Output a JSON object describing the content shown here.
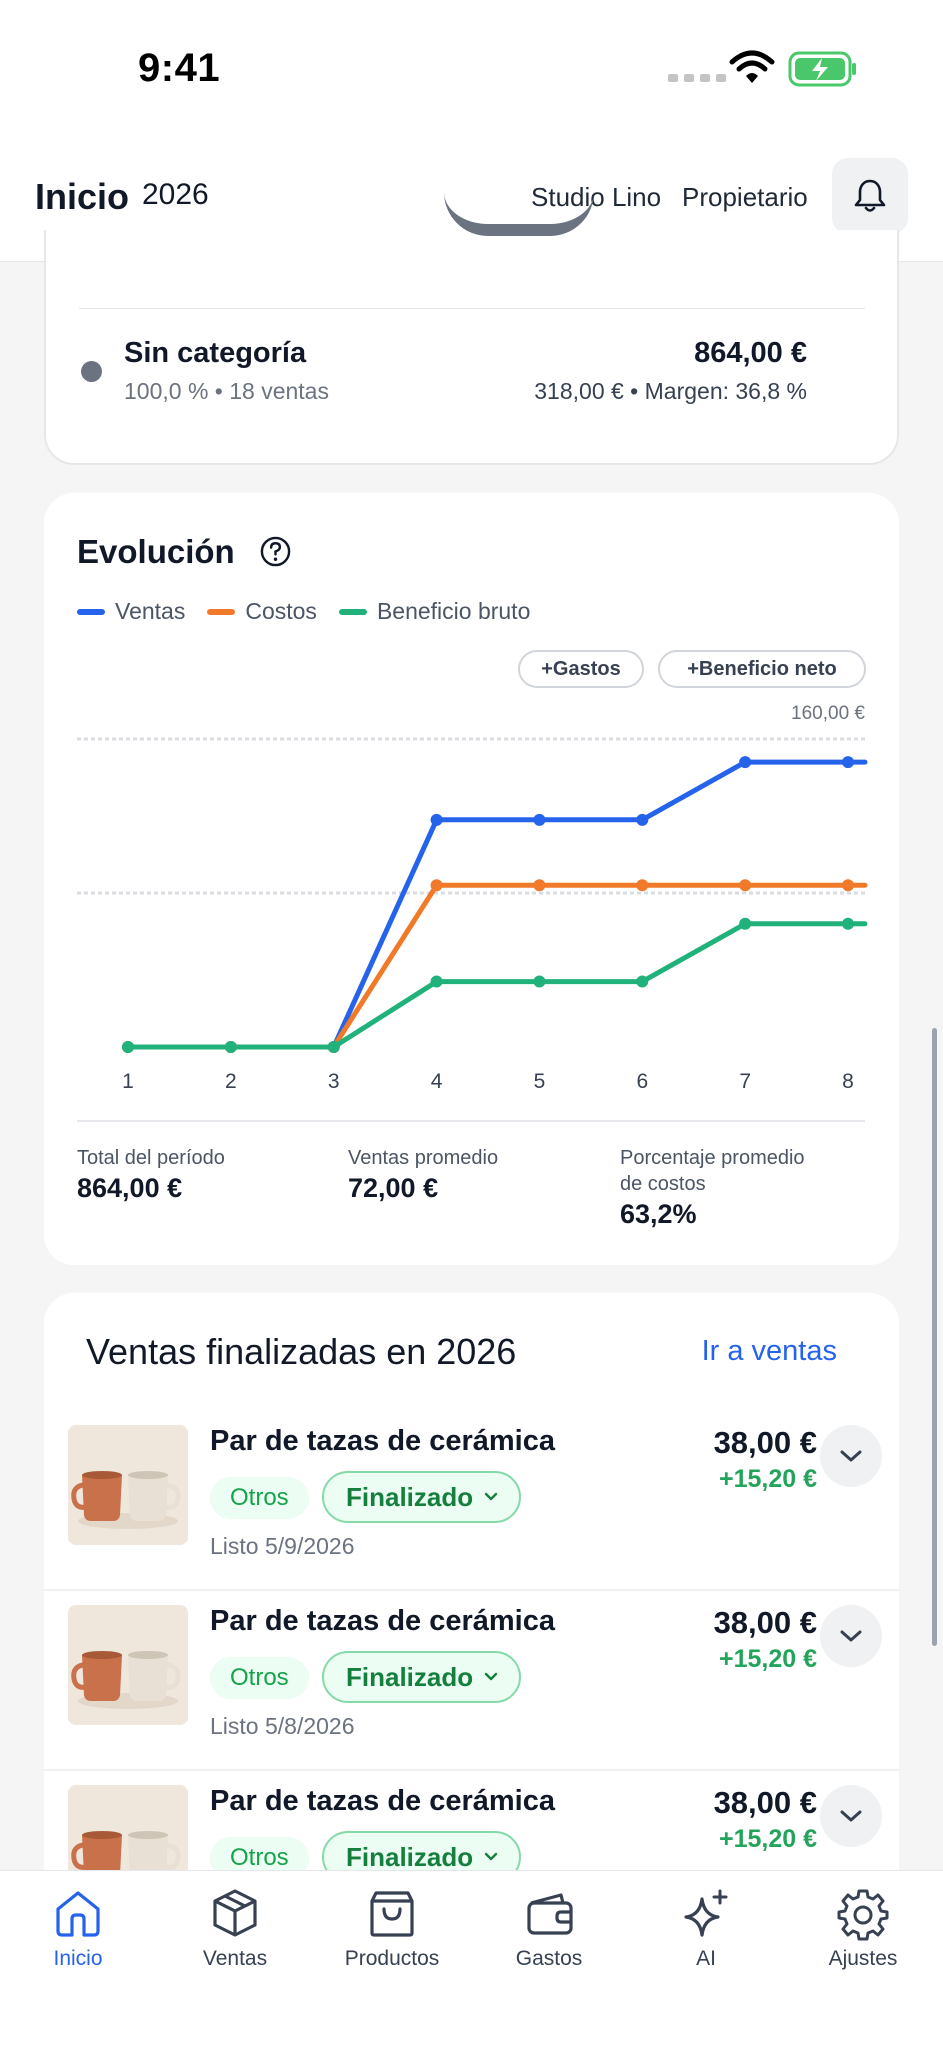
{
  "status_bar": {
    "time": "9:41"
  },
  "header": {
    "title": "Inicio",
    "year": "2026",
    "store": "Studio Lino",
    "role": "Propietario",
    "bell_icon": "bell-icon"
  },
  "category": {
    "name": "Sin categoría",
    "share_and_count": "100,0 %  •  18 ventas",
    "total": "864,00 €",
    "cost_and_margin": "318,00 €  •  Margen: 36,8 %",
    "dot_color": "#6b7280"
  },
  "evolution": {
    "title": "Evolución",
    "help_icon": "question-circle-icon",
    "legend": [
      {
        "label": "Ventas",
        "color": "#2563eb"
      },
      {
        "label": "Costos",
        "color": "#f07a2a"
      },
      {
        "label": "Beneficio bruto",
        "color": "#20b27a"
      }
    ],
    "chips": {
      "gastos": "+Gastos",
      "beneficio_neto": "+Beneficio neto"
    },
    "stats": {
      "total_label": "Total del período",
      "total_value": "864,00 €",
      "avg_label": "Ventas promedio",
      "avg_value": "72,00 €",
      "cost_pct_label_1": "Porcentaje promedio",
      "cost_pct_label_2": "de costos",
      "cost_pct_value": "63,2%"
    }
  },
  "chart_data": {
    "type": "line",
    "x": [
      "1",
      "2",
      "3",
      "4",
      "5",
      "6",
      "7",
      "8"
    ],
    "y_max_label": "160,00 €",
    "ylim": [
      0,
      160
    ],
    "gridlines": [
      160,
      80
    ],
    "series": [
      {
        "name": "Ventas",
        "color": "#2563eb",
        "values": [
          0,
          0,
          0,
          118,
          118,
          118,
          148,
          148
        ]
      },
      {
        "name": "Costos",
        "color": "#f07a2a",
        "values": [
          0,
          0,
          0,
          84,
          84,
          84,
          84,
          84
        ]
      },
      {
        "name": "Beneficio bruto",
        "color": "#20b27a",
        "values": [
          0,
          0,
          0,
          34,
          34,
          34,
          64,
          64
        ]
      }
    ]
  },
  "sales": {
    "title": "Ventas finalizadas en 2026",
    "link": "Ir a ventas",
    "items": [
      {
        "name": "Par de tazas de cerámica",
        "category": "Otros",
        "status": "Finalizado",
        "ready": "Listo 5/9/2026",
        "price": "38,00 €",
        "profit": "+15,20 €"
      },
      {
        "name": "Par de tazas de cerámica",
        "category": "Otros",
        "status": "Finalizado",
        "ready": "Listo 5/8/2026",
        "price": "38,00 €",
        "profit": "+15,20 €"
      },
      {
        "name": "Par de tazas de cerámica",
        "category": "Otros",
        "status": "Finalizado",
        "ready": "",
        "price": "38,00 €",
        "profit": "+15,20 €"
      }
    ]
  },
  "tabs": [
    {
      "label": "Inicio",
      "icon": "home-icon",
      "active": true
    },
    {
      "label": "Ventas",
      "icon": "box-icon",
      "active": false
    },
    {
      "label": "Productos",
      "icon": "shopping-bag-icon",
      "active": false
    },
    {
      "label": "Gastos",
      "icon": "wallet-icon",
      "active": false
    },
    {
      "label": "AI",
      "icon": "sparkles-icon",
      "active": false
    },
    {
      "label": "Ajustes",
      "icon": "gear-icon",
      "active": false
    }
  ],
  "colors": {
    "accent": "#2563eb",
    "success": "#16a34a"
  }
}
